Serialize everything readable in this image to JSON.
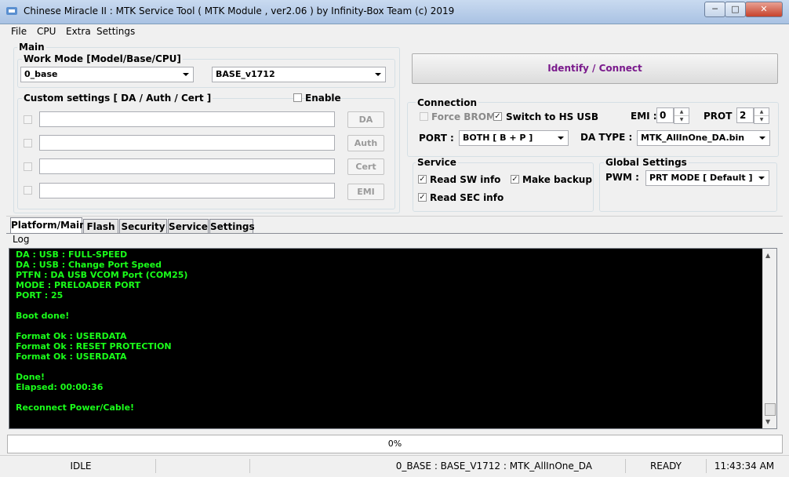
{
  "window": {
    "title": "Chinese Miracle II : MTK Service Tool ( MTK Module , ver2.06  ) by Infinity-Box Team (c) 2019",
    "minimize": "─",
    "maximize": "□",
    "close": "✕"
  },
  "menu": [
    "File",
    "CPU",
    "Extra",
    "Settings"
  ],
  "main": {
    "group_label": "Main",
    "work_mode_label": "Work Mode [Model/Base/CPU]",
    "work_mode_value": "0_base",
    "base_value": "BASE_v1712",
    "custom_label": "Custom settings [ DA / Auth / Cert ]",
    "enable_label": "Enable",
    "custom_buttons": [
      "DA",
      "Auth",
      "Cert",
      "EMI"
    ]
  },
  "identify_button": "Identify / Connect",
  "connection": {
    "label": "Connection",
    "force_brom": "Force BROM",
    "switch_hs": "Switch to HS USB",
    "emi_label": "EMI :",
    "emi_value": "0",
    "prot_label": "PROT :",
    "prot_value": "2",
    "port_label": "PORT :",
    "port_value": "BOTH [ B + P ]",
    "da_type_label": "DA TYPE :",
    "da_type_value": "MTK_AllInOne_DA.bin"
  },
  "service": {
    "label": "Service",
    "read_sw": "Read SW info",
    "make_backup": "Make backup",
    "read_sec": "Read SEC info"
  },
  "global": {
    "label": "Global Settings",
    "pwm_label": "PWM :",
    "pwm_value": "PRT MODE [ Default ]"
  },
  "tabs": [
    "Platform/Main",
    "Flash",
    "Security",
    "Service",
    "Settings"
  ],
  "log_label": "Log",
  "log_lines": [
    "DA : USB : FULL-SPEED",
    "DA : USB : Change Port Speed",
    "PTFN : DA USB VCOM Port (COM25)",
    "MODE : PRELOADER PORT",
    "PORT : 25",
    "",
    "Boot done!",
    "",
    "Format Ok : USERDATA",
    "Format Ok : RESET PROTECTION",
    "Format Ok : USERDATA",
    "",
    "Done!",
    "Elapsed: 00:00:36",
    "",
    "Reconnect Power/Cable!"
  ],
  "progress": {
    "text": "0%",
    "value": 0
  },
  "status": {
    "state": "IDLE",
    "info": "0_BASE : BASE_V1712 : MTK_AllInOne_DA",
    "ready": "READY",
    "time": "11:43:34 AM"
  },
  "colors": {
    "log_text": "#1aff1a",
    "identify_text": "#7a1a8c"
  }
}
